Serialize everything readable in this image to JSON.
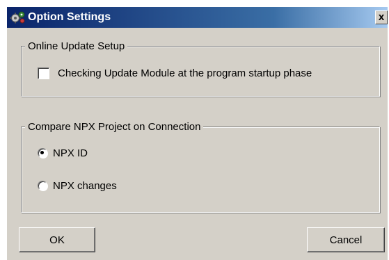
{
  "window": {
    "title": "Option Settings",
    "icon": "gears-icon",
    "close_label": "x"
  },
  "online_update": {
    "legend": "Online Update Setup",
    "checkbox_label": "Checking Update Module at the program startup phase",
    "checked": false
  },
  "compare_npx": {
    "legend": "Compare NPX Project on Connection",
    "options": [
      {
        "label": "NPX ID",
        "selected": true
      },
      {
        "label": "NPX changes",
        "selected": false
      }
    ]
  },
  "buttons": {
    "ok_label": "OK",
    "cancel_label": "Cancel"
  },
  "colors": {
    "face": "#d4d0c8",
    "title_start": "#0a246a",
    "title_end": "#a6caf0"
  }
}
